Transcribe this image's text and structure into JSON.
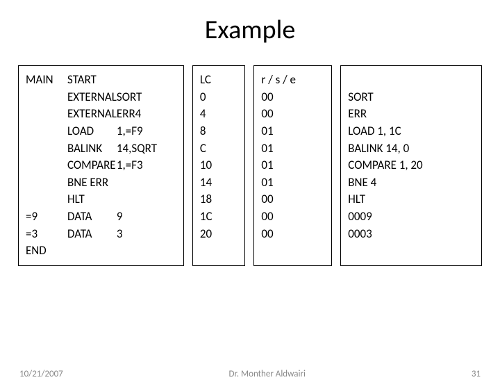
{
  "title": "Example",
  "box1": {
    "labels": [
      "MAIN",
      "",
      "",
      "",
      "",
      "",
      "",
      "",
      "=9",
      "=3",
      "END"
    ],
    "mnemonics": [
      "START",
      "EXTERNAL",
      "EXTERNAL",
      "LOAD",
      "BALINK",
      "COMPARE",
      "BNE ERR",
      "HLT",
      "DATA",
      "DATA",
      ""
    ],
    "operands": [
      "",
      "SORT",
      "ERR4",
      "1,=F9",
      "14,SQRT",
      "1,=F3",
      "",
      "",
      "9",
      "3",
      ""
    ]
  },
  "lc": [
    "LC",
    "0",
    "4",
    "8",
    "C",
    "10",
    "14",
    "18",
    "1C",
    "20",
    ""
  ],
  "rse": [
    "r / s / e",
    "00",
    "00",
    "01",
    "01",
    "01",
    "01",
    "00",
    "00",
    "00",
    ""
  ],
  "out": [
    "",
    "SORT",
    "ERR",
    "LOAD 1, 1C",
    "BALINK 14, 0",
    "COMPARE 1, 20",
    "BNE 4",
    "HLT",
    "0009",
    "0003",
    ""
  ],
  "footer": {
    "date": "10/21/2007",
    "author": "Dr. Monther Aldwairi",
    "page": "31"
  }
}
